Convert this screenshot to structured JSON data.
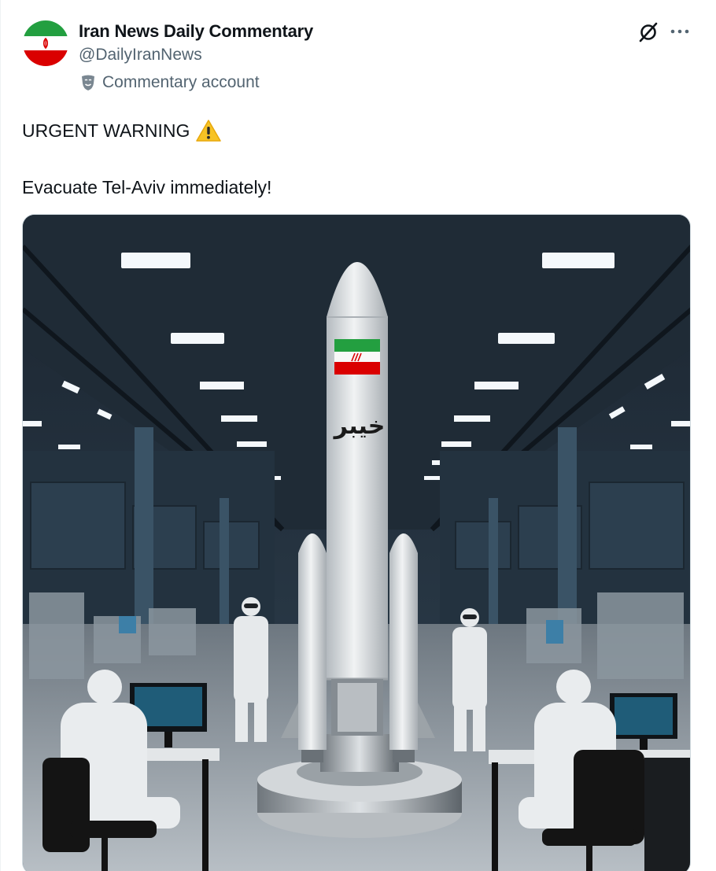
{
  "post": {
    "display_name": "Iran News Daily Commentary",
    "handle": "@DailyIranNews",
    "account_label": "Commentary account",
    "text_line1": "URGENT WARNING",
    "text_line2": "Evacuate Tel-Aviv immediately!",
    "media": {
      "rocket_text": "خيبر"
    }
  },
  "icons": {
    "avatar": "iran-flag",
    "label": "theater-mask-icon",
    "grok": "grok-icon",
    "more": "more-icon",
    "warning": "warning-emoji"
  },
  "colors": {
    "text": "#0f1419",
    "secondary": "#536471",
    "flag_green": "#239f40",
    "flag_red": "#da0000"
  }
}
